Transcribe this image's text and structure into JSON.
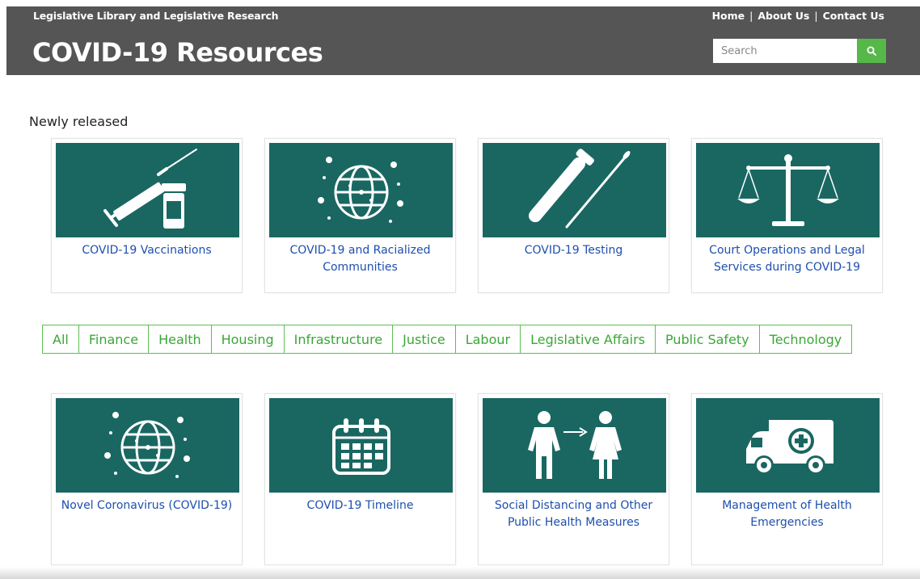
{
  "header": {
    "org_name": "Legislative Library and Legislative Research",
    "title": "COVID-19 Resources",
    "links": [
      "Home",
      "About Us",
      "Contact Us"
    ],
    "search_placeholder": "Search",
    "header_bg": "#555555",
    "search_button_color": "#57b84a"
  },
  "section_label": "Newly released",
  "featured_cards": [
    {
      "label": "COVID-19 Vaccinations",
      "icon": "syringe-vial-icon"
    },
    {
      "label": "COVID-19 and Racialized Communities",
      "icon": "globe-virus-icon"
    },
    {
      "label": "COVID-19 Testing",
      "icon": "test-tube-swab-icon"
    },
    {
      "label": "Court Operations and Legal Services during COVID-19",
      "icon": "scales-of-justice-icon"
    }
  ],
  "filters": [
    "All",
    "Finance",
    "Health",
    "Housing",
    "Infrastructure",
    "Justice",
    "Labour",
    "Legislative Affairs",
    "Public Safety",
    "Technology"
  ],
  "topic_cards": [
    {
      "label": "Novel Coronavirus (COVID-19)",
      "icon": "globe-virus-icon"
    },
    {
      "label": "COVID-19 Timeline",
      "icon": "calendar-icon"
    },
    {
      "label": "Social Distancing and Other Public Health Measures",
      "icon": "people-distancing-icon"
    },
    {
      "label": "Management of Health Emergencies",
      "icon": "ambulance-icon"
    }
  ],
  "colors": {
    "tile_bg": "#1a6762",
    "link": "#1d4fae",
    "filter_green": "#3aa736"
  }
}
